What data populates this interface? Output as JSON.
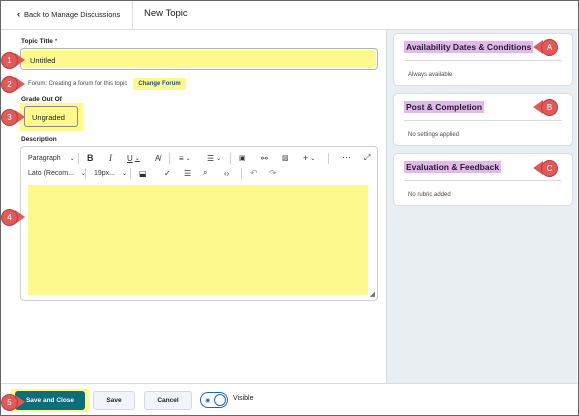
{
  "header": {
    "back_label": "Back to Manage Discussions",
    "title": "New Topic"
  },
  "form": {
    "topic_title_label": "Topic Title",
    "topic_title_required": "*",
    "topic_title_value": "Untitled",
    "forum_text": "Forum: Creating a forum for this topic",
    "change_forum": "Change Forum",
    "grade_label": "Grade Out Of",
    "grade_value": "Ungraded",
    "description_label": "Description"
  },
  "toolbar": {
    "paragraph": "Paragraph",
    "font": "Lato (Recom...",
    "size": "19px..."
  },
  "panels": [
    {
      "title": "Availability Dates & Conditions",
      "body": "Always available"
    },
    {
      "title": "Post & Completion",
      "body": "No settings applied"
    },
    {
      "title": "Evaluation & Feedback",
      "body": "No rubric added"
    }
  ],
  "footer": {
    "save_close": "Save and Close",
    "save": "Save",
    "cancel": "Cancel",
    "visible": "Visible"
  },
  "callouts": {
    "n1": "1",
    "n2": "2",
    "n3": "3",
    "n4": "4",
    "n5": "5",
    "a": "A",
    "b": "B",
    "c": "C"
  },
  "colors": {
    "highlight_yellow": "#fdf98c",
    "highlight_purple": "#e3b8ef",
    "callout_red": "#e05a5a",
    "primary_button": "#0b6e78",
    "side_panel_bg": "#e9eef3"
  }
}
